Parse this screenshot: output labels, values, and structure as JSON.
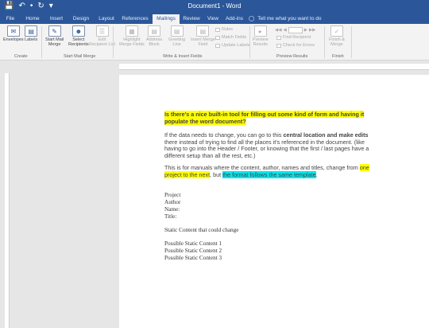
{
  "titlebar": {
    "doc_title": "Document1 - Word",
    "qat": [
      "💾",
      "↶",
      "•",
      "↻",
      "▾"
    ]
  },
  "tabs": [
    {
      "label": "File"
    },
    {
      "label": "Home"
    },
    {
      "label": "Insert"
    },
    {
      "label": "Design"
    },
    {
      "label": "Layout"
    },
    {
      "label": "References"
    },
    {
      "label": "Mailings",
      "active": true
    },
    {
      "label": "Review"
    },
    {
      "label": "View"
    },
    {
      "label": "Add-ins"
    }
  ],
  "tellme": "Tell me what you want to do",
  "ribbon": {
    "create": {
      "envelopes": "Envelopes",
      "labels": "Labels",
      "group": "Create"
    },
    "start": {
      "start_mail_merge": "Start Mail\nMerge",
      "select_recipients": "Select\nRecipients",
      "edit_recipient_list": "Edit\nRecipient List",
      "group": "Start Mail Merge"
    },
    "write": {
      "highlight_fields": "Highlight\nMerge Fields",
      "address_block": "Address\nBlock",
      "greeting_line": "Greeting\nLine",
      "insert_merge_field": "Insert Merge\nField",
      "rules": "Rules",
      "match_fields": "Match Fields",
      "update_labels": "Update Labels",
      "group": "Write & Insert Fields"
    },
    "preview": {
      "preview_results": "Preview\nResults",
      "find_recipient": "Find Recipient",
      "check_for_errors": "Check for Errors",
      "group": "Preview Results"
    },
    "finish": {
      "finish_merge": "Finish &\nMerge",
      "group": "Finish"
    }
  },
  "colors": {
    "accent": "#2b579a",
    "highlight_yellow": "#ffff00",
    "highlight_cyan": "#00e5ee"
  },
  "document": {
    "p1": "Is there's a nice built-in tool for filling out some kind of form and having it populate the word document?",
    "p2_a": "If the data needs to change, you can go to this ",
    "p2_b": "central location and make edits",
    "p2_c": " there instead of trying to find all the places it's referenced in the document. (like having to go into the Header / Footer, or knowing that the first / last pages have a different setup than all the rest, etc.)",
    "p3_a": "This is for manuals where the content, author, names and titles, change from ",
    "p3_b": "one project to the next",
    "p3_c": ", but ",
    "p3_d": "the format follows the same template",
    "p3_e": ".",
    "fields": [
      "Project",
      "Author",
      "Name:",
      "Title:"
    ],
    "static_note": "Static Content that could change",
    "possible": [
      "Possible Static Content 1",
      "Possible Static Content 2",
      "Possible Static Content 3"
    ]
  }
}
